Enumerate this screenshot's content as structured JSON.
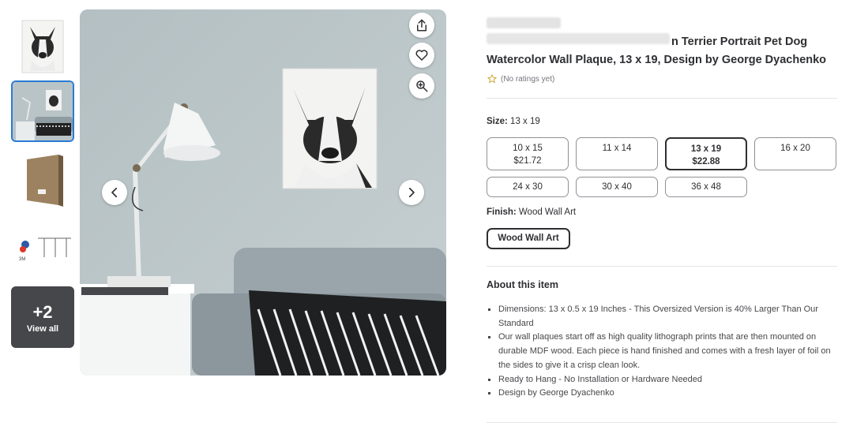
{
  "gallery": {
    "thumbnails": [
      {
        "name": "thumb-portrait"
      },
      {
        "name": "thumb-room"
      },
      {
        "name": "thumb-side"
      },
      {
        "name": "thumb-hardware"
      }
    ],
    "view_all": {
      "count": "+2",
      "label": "View all"
    },
    "active_index": 1
  },
  "main_image": {
    "actions": [
      "share-icon",
      "heart-icon",
      "zoom-in-icon"
    ],
    "nav": [
      "chevron-left-icon",
      "chevron-right-icon"
    ]
  },
  "product": {
    "title_line1": "n Terrier Portrait Pet Dog",
    "title_line2": "Watercolor Wall Plaque, 13 x 19, Design by George Dyachenko",
    "rating_text": "(No ratings yet)",
    "size_label": "Size:",
    "size_value": "13 x 19",
    "sizes": [
      {
        "name": "10 x 15",
        "price": "$21.72"
      },
      {
        "name": "11 x 14",
        "price": ""
      },
      {
        "name": "13 x 19",
        "price": "$22.88"
      },
      {
        "name": "16 x 20",
        "price": ""
      },
      {
        "name": "24 x 30",
        "price": ""
      },
      {
        "name": "30 x 40",
        "price": ""
      },
      {
        "name": "36 x 48",
        "price": ""
      }
    ],
    "selected_size_index": 2,
    "finish_label": "Finish:",
    "finish_value": "Wood Wall Art",
    "finish_option": "Wood Wall Art"
  },
  "about": {
    "title": "About this item",
    "bullets": [
      "Dimensions: 13 x 0.5 x 19 Inches - This Oversized Version is 40% Larger Than Our Standard",
      "Our wall plaques start off as high quality lithograph prints that are then mounted on durable MDF wood. Each piece is hand finished and comes with a fresh layer of foil on the sides to give it a crisp clean look.",
      "Ready to Hang - No Installation or Hardware Needed",
      "Design by George Dyachenko"
    ]
  },
  "colors": {
    "selected_border": "#2e2f32",
    "active_thumb_border": "#2a7bd4",
    "wall": "#b9c4c7"
  }
}
